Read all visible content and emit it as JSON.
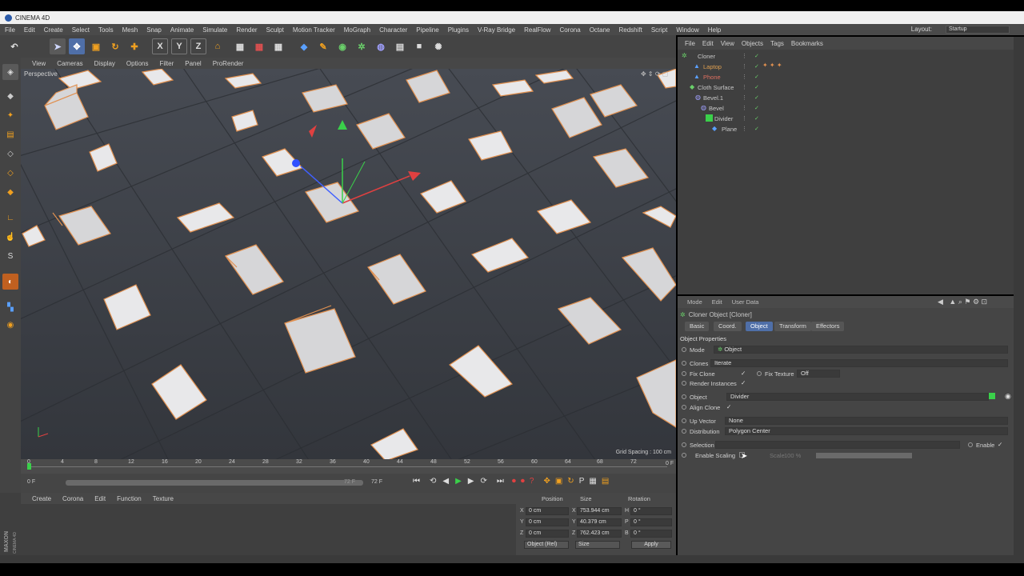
{
  "app": {
    "title": "CINEMA 4D"
  },
  "menubar": {
    "items": [
      "File",
      "Edit",
      "Create",
      "Select",
      "Tools",
      "Mesh",
      "Snap",
      "Animate",
      "Simulate",
      "Render",
      "Sculpt",
      "Motion Tracker",
      "MoGraph",
      "Character",
      "Pipeline",
      "Plugins",
      "V-Ray Bridge",
      "RealFlow",
      "Corona",
      "Octane",
      "Redshift",
      "Script",
      "Window",
      "Help"
    ],
    "layout_label": "Layout:",
    "layout_value": "Startup"
  },
  "viewport": {
    "menu": [
      "View",
      "Cameras",
      "Display",
      "Options",
      "Filter",
      "Panel",
      "ProRender"
    ],
    "name": "Perspective",
    "grid_spacing": "Grid Spacing : 100 cm"
  },
  "timeline": {
    "ticks": [
      "0",
      "4",
      "8",
      "12",
      "16",
      "20",
      "24",
      "28",
      "32",
      "36",
      "40",
      "44",
      "48",
      "52",
      "56",
      "60",
      "64",
      "68",
      "72"
    ],
    "end_frame_label": "0 F",
    "current_frame": "0 F",
    "range_end": "72 F",
    "max_frame": "72 F"
  },
  "material_menu": [
    "Create",
    "Corona",
    "Edit",
    "Function",
    "Texture"
  ],
  "maxon": "MAXON CINEMA 4D",
  "coords": {
    "headers": [
      "Position",
      "Size",
      "Rotation"
    ],
    "rows": [
      {
        "axis": "X",
        "pos": "0 cm",
        "size_axis": "X",
        "size": "753.944 cm",
        "rot_axis": "H",
        "rot": "0 °"
      },
      {
        "axis": "Y",
        "pos": "0 cm",
        "size_axis": "Y",
        "size": "40.379 cm",
        "rot_axis": "P",
        "rot": "0 °"
      },
      {
        "axis": "Z",
        "pos": "0 cm",
        "size_axis": "Z",
        "size": "762.423 cm",
        "rot_axis": "B",
        "rot": "0 °"
      }
    ],
    "mode": "Object (Rel)",
    "size_mode": "Size",
    "apply": "Apply"
  },
  "objects": {
    "menu": [
      "File",
      "Edit",
      "View",
      "Objects",
      "Tags",
      "Bookmarks"
    ],
    "tree": [
      {
        "name": "Cloner",
        "indent": 0,
        "color": "#7fb3ff"
      },
      {
        "name": "Laptop",
        "indent": 1,
        "color": "#e0a050"
      },
      {
        "name": "Phone",
        "indent": 1,
        "color": "#e0a050"
      },
      {
        "name": "Cloth Surface",
        "indent": 0,
        "color": "#cfcfcf"
      },
      {
        "name": "Bevel.1",
        "indent": 1,
        "color": "#cfcfcf"
      },
      {
        "name": "Bevel",
        "indent": 2,
        "color": "#cfcfcf"
      },
      {
        "name": "Divider",
        "indent": 3,
        "color": "#cfcfcf"
      },
      {
        "name": "Plane",
        "indent": 4,
        "color": "#cfcfcf"
      }
    ]
  },
  "attributes": {
    "menu": [
      "Mode",
      "Edit",
      "User Data"
    ],
    "object_title": "Cloner Object [Cloner]",
    "tabs": [
      "Basic",
      "Coord.",
      "Object",
      "Transform",
      "Effectors"
    ],
    "active_tab": "Object",
    "section": "Object Properties",
    "mode_label": "Mode",
    "mode_value": "Object",
    "clones_label": "Clones",
    "clones_value": "Iterate",
    "fix_clone_label": "Fix Clone",
    "fix_texture_label": "Fix Texture",
    "fix_texture_value": "Off",
    "render_instances_label": "Render Instances",
    "object_label": "Object",
    "object_value": "Divider",
    "align_clone_label": "Align Clone",
    "up_vector_label": "Up Vector",
    "up_vector_value": "None",
    "distribution_label": "Distribution",
    "distribution_value": "Polygon Center",
    "selection_label": "Selection",
    "enable_label": "Enable",
    "enable_scaling_label": "Enable Scaling",
    "scale_label": "Scale",
    "scale_value": "100 %",
    "check": "✓"
  },
  "colors": {
    "accent": "#4f6fa8",
    "orange_outline": "#e09050",
    "floor": "#3d4148"
  }
}
